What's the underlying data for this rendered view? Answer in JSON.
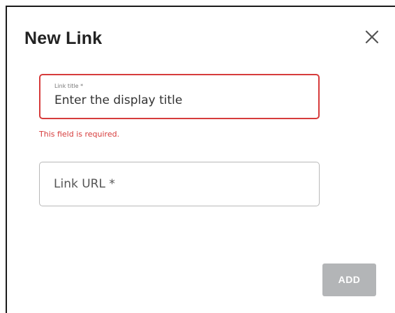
{
  "dialog": {
    "title": "New Link",
    "close_icon": "close-icon"
  },
  "fields": {
    "link_title": {
      "label": "Link title *",
      "placeholder": "Enter the display title",
      "value": "",
      "error": "This field is required.",
      "error_color": "#d63b3b"
    },
    "link_url": {
      "placeholder": "Link URL *",
      "value": ""
    }
  },
  "actions": {
    "add_label": "ADD",
    "add_disabled": true
  },
  "colors": {
    "error": "#d63b3b",
    "button_disabled": "#b3b5b7",
    "title_text": "#222222"
  }
}
